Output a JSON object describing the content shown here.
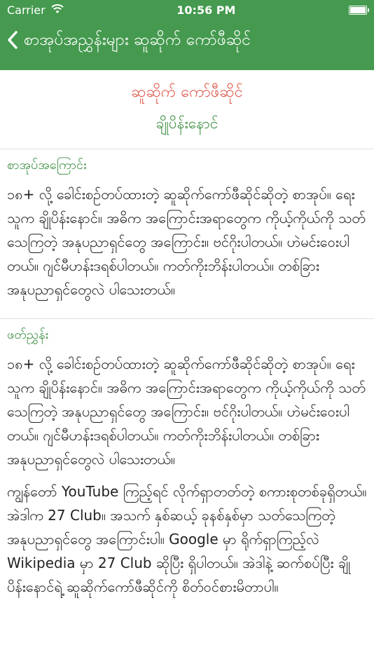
{
  "status_bar": {
    "carrier": "Carrier",
    "time": "10:56 PM"
  },
  "nav": {
    "title": "စာအုပ်အညွှန်းများ ဆူဆိုက် ကော်ဖီဆိုင်"
  },
  "book": {
    "title": "ဆူဆိုက် ကော်ဖီဆိုင်",
    "author": "ချိုပိန်းနောင်"
  },
  "sections": {
    "about": {
      "title": "စာအုပ်အကြောင်း",
      "text": "၁၈+ လို့ ခေါင်းစဉ်တပ်ထားတဲ့ ဆူဆိုက်ကော်ဖီဆိုင်ဆိုတဲ့ စာအုပ်။ ရေးသူက ချိုပိန်းနောင်။ အဓိက အကြောင်းအရာတွေက ကိုယ့်ကိုယ်ကို သတ်သေကြတဲ့ အနုပညာရှင်တွေ အကြောင်း။ ဗင်ဂိုးပါတယ်။ ဟဲမင်းဝေးပါတယ်။ ဂျင်မီဟန်းဒရစ်ပါတယ်။ ကတ်ကိုးဘိန်းပါတယ်။ တစ်ခြား အနုပညာရှင်တွေလဲ ပါသေးတယ်။"
    },
    "review": {
      "title": "ဖတ်ညွှန်း",
      "text1": "၁၈+ လို့ ခေါင်းစဉ်တပ်ထားတဲ့ ဆူဆိုက်ကော်ဖီဆိုင်ဆိုတဲ့ စာအုပ်။ ရေးသူက ချိုပိန်းနောင်။ အဓိက အကြောင်းအရာတွေက ကိုယ့်ကိုယ်ကို သတ်သေကြတဲ့ အနုပညာရှင်တွေ အကြောင်း။ ဗင်ဂိုးပါတယ်။ ဟဲမင်းဝေးပါတယ်။ ဂျင်မီဟန်းဒရစ်ပါတယ်။ ကတ်ကိုးဘိန်းပါတယ်။ တစ်ခြား အနုပညာရှင်တွေလဲ ပါသေးတယ်။",
      "text2": "ကျွန်တော် YouTube ကြည့်ရင် လိုက်ရှာတတ်တဲ့ စကားစုတစ်ခုရှိတယ်။ အဲဒါက 27 Club။ အသက် နှစ်ဆယ့် ခုနစ်နှစ်မှာ သတ်သေကြတဲ့ အနုပညာရှင်တွေ အကြောင်းပါ။ Google မှာ ရိုက်ရှာကြည့်လဲ Wikipedia မှာ 27 Club ဆိုပြီး ရှိပါတယ်။ အဲဒါနဲ့ ဆက်စပ်ပြီး ချိုပိန်းနောင်ရဲ့ ဆူဆိုက်ကော်ဖီဆိုင်ကို စိတ်ဝင်စားမိတာပါ။"
    }
  },
  "colors": {
    "header_bg": "#459a4f",
    "book_title": "#e0594b",
    "accent_green": "#3a8c3f"
  }
}
